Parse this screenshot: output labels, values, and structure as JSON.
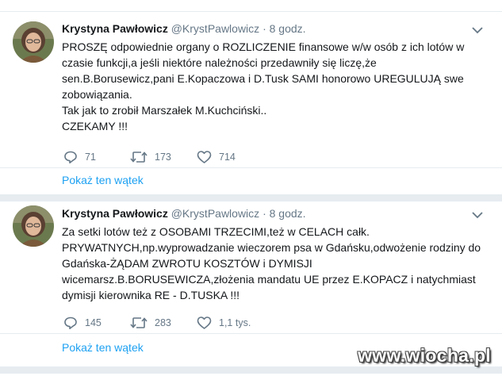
{
  "tweets": [
    {
      "name": "Krystyna Pawłowicz",
      "handle": "@KrystPawlowicz",
      "dot": "·",
      "time": "8 godz.",
      "lines": [
        "PROSZĘ odpowiednie organy o ROZLICZENIE finansowe w/w osób z ich lotów w",
        "czasie funkcji,a jeśli niektóre należności przedawniły się liczę,że",
        "sen.B.Borusewicz,pani E.Kopaczowa i D.Tusk SAMI honorowo UREGULUJĄ swe",
        "zobowiązania.",
        "Tak jak to zrobił Marszałek M.Kuchciński..",
        "CZEKAMY !!!"
      ],
      "replies": "71",
      "retweets": "173",
      "likes": "714",
      "thread_link": "Pokaż ten wątek"
    },
    {
      "name": "Krystyna Pawłowicz",
      "handle": "@KrystPawlowicz",
      "dot": "·",
      "time": "8 godz.",
      "lines": [
        "Za setki lotów też z OSOBAMI TRZECIMI,też w CELACH całk.",
        "PRYWATNYCH,np.wyprowadzanie wieczorem psa w Gdańsku,odwożenie rodziny do",
        "Gdańska-ŻĄDAM  ZWROTU KOSZTÓW i DYMISJI",
        "wicemarsz.B.BORUSEWICZA,złożenia mandatu UE przez E.KOPACZ i natychmiast",
        "dymisji kierownika RE - D.TUSKA !!!"
      ],
      "replies": "145",
      "retweets": "283",
      "likes": "1,1 tys.",
      "thread_link": "Pokaż ten wątek"
    }
  ],
  "watermark": "www.wiocha.pl",
  "colors": {
    "link": "#1da1f2",
    "muted": "#657786",
    "border": "#e6ecf0"
  },
  "icons": [
    "reply-icon",
    "retweet-icon",
    "like-icon",
    "chevron-down-icon"
  ]
}
